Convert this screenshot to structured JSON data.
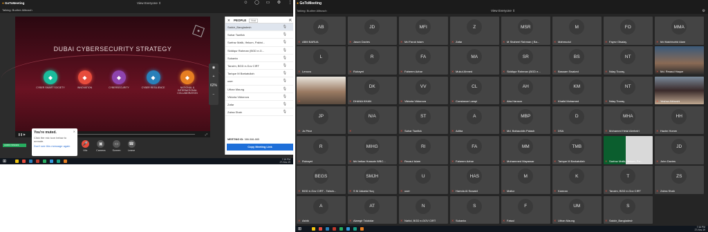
{
  "left": {
    "app": "GoToMeeting",
    "talking": "Talking: Budhre Alibusch",
    "view_label": "View Everyone",
    "presentation": {
      "title": "DUBAI CYBERSECURITY STRATEGY",
      "pillars": [
        {
          "label": "CYBER SMART SOCIETY",
          "color": "#1abc9c"
        },
        {
          "label": "INNOVATION",
          "color": "#e74c3c"
        },
        {
          "label": "CYBERSECURITY",
          "color": "#8e44ad"
        },
        {
          "label": "CYBER RESILIENCE",
          "color": "#2980b9"
        },
        {
          "label": "NATIONAL & INTERNATIONAL COLLABORATION",
          "color": "#e67e22"
        }
      ]
    },
    "zoom_level": "62%",
    "people": {
      "header": "PEOPLE",
      "tag": "Host",
      "items": [
        "Sakkir_Bangladesh",
        "Sahar Tawfick",
        "Sarfraz Malik, Ifekum, Pakist...",
        "Siddiqur Rahman (BGD e-G...",
        "Sukanta",
        "Tanzim, BGD e-Gov CIRT",
        "Tarique M Barkatullah",
        "user",
        "Uthan Maung",
        "Viktoria Viktorova",
        "Zafar",
        "Zahra Shah"
      ],
      "meeting_id_label": "MEETING ID:",
      "meeting_id": "386-566-885",
      "copy_btn": "Copy Meeting Link"
    },
    "muted": {
      "title": "You're muted.",
      "hint": "Click the mic icon below to unmute.",
      "link": "Don't see this message again"
    },
    "controls": [
      {
        "label": "Mic",
        "icon": "🎤",
        "color": "#e74c3c"
      },
      {
        "label": "Camera",
        "icon": "▣",
        "color": "#555"
      },
      {
        "label": "Screen",
        "icon": "▭",
        "color": "#555"
      },
      {
        "label": "Leave",
        "icon": "☎",
        "color": "#555"
      }
    ],
    "audio_label": "AUDIO ISSUES",
    "clock_time": "7:15 PM",
    "clock_date": "27-Nov-19"
  },
  "right": {
    "app": "GoToMeeting",
    "talking": "Talking: Budhre Alibusch",
    "view_label": "View Everyone",
    "tiles": [
      {
        "i": "AB",
        "n": "ABM BARUA"
      },
      {
        "i": "JD",
        "n": "Jason Davies"
      },
      {
        "i": "MFI",
        "n": "Md Faruk Islam"
      },
      {
        "i": "Z",
        "n": "Zafar"
      },
      {
        "i": "MSR",
        "n": "M Shaheel Rahman ( Ba..."
      },
      {
        "i": "M",
        "n": "Mahmudul"
      },
      {
        "i": "FO",
        "n": "Fayez Olsaiay"
      },
      {
        "i": "MMA",
        "n": "Md Makhbuhid Alam"
      },
      {
        "i": "L",
        "n": "Lenovo"
      },
      {
        "i": "R",
        "n": "Rubayet"
      },
      {
        "i": "FA",
        "n": "Faheem Azhar"
      },
      {
        "i": "MA",
        "n": "Mukul Ahmed"
      },
      {
        "i": "SR",
        "n": "Siddiqur Rahman (BGD e..."
      },
      {
        "i": "BS",
        "n": "Bassam Swaked"
      },
      {
        "i": "NT",
        "n": "Nday Touray"
      },
      {
        "i": "",
        "n": "Md. Reaaul Haque",
        "photo": "glasses"
      },
      {
        "i": "",
        "n": "",
        "photo": "man"
      },
      {
        "i": "DK",
        "n": "DHANA KHAN"
      },
      {
        "i": "VV",
        "n": "Viktoria Viktorova"
      },
      {
        "i": "CL",
        "n": "Constance Lampl"
      },
      {
        "i": "AH",
        "n": "Aba Hanson"
      },
      {
        "i": "KM",
        "n": "Khalid Mohamed"
      },
      {
        "i": "NT",
        "n": "Nday Touray"
      },
      {
        "i": "",
        "n": "Yeshra Alkhoshi",
        "photo": "woman"
      },
      {
        "i": "JP",
        "n": "Jo Price"
      },
      {
        "i": "N/A",
        "n": ""
      },
      {
        "i": "ST",
        "n": "Sahar Tawfick"
      },
      {
        "i": "A",
        "n": "Adiba"
      },
      {
        "i": "MBP",
        "n": "Md. Bahauddin Palash"
      },
      {
        "i": "D",
        "n": "DSA"
      },
      {
        "i": "MHA",
        "n": "Mohamed Helal Alreheiri"
      },
      {
        "i": "HH",
        "n": "Hazim Homer"
      },
      {
        "i": "R",
        "n": "Rubayet"
      },
      {
        "i": "MIHG",
        "n": "Md Imtiaz Hussain WBC..."
      },
      {
        "i": "RI",
        "n": "Rezaul Islam"
      },
      {
        "i": "FA",
        "n": "Faheem Azhar"
      },
      {
        "i": "MM",
        "n": "Mohammed Mayassar"
      },
      {
        "i": "TMB",
        "n": "Tarique M Barkatullah"
      },
      {
        "i": "",
        "n": "Sarfraz Malik, Ifekum, Pa...",
        "photo": "flag"
      },
      {
        "i": "JD",
        "n": "John Davies"
      },
      {
        "i": "BEGS",
        "n": "BGD e-Gov CIRT - Tahsin..."
      },
      {
        "i": "SMJH",
        "n": "S M Jakaria Huq"
      },
      {
        "i": "U",
        "n": "user"
      },
      {
        "i": "HAS",
        "n": "Hamda Al Suwaidi"
      },
      {
        "i": "M",
        "n": "Maitur"
      },
      {
        "i": "K",
        "n": "Kamran"
      },
      {
        "i": "T",
        "n": "Tanzim, BGD e-Gov CIRT"
      },
      {
        "i": "ZS",
        "n": "Zahra Shah"
      },
      {
        "i": "A",
        "n": "Ashik"
      },
      {
        "i": "AT",
        "n": "Alamgir Talukdar"
      },
      {
        "i": "N",
        "n": "Nahid, BGD e-GOV CIRT"
      },
      {
        "i": "S",
        "n": "Sukanta"
      },
      {
        "i": "F",
        "n": "Faisal"
      },
      {
        "i": "UM",
        "n": "Uthan Maung"
      },
      {
        "i": "S",
        "n": "Sakkir_Bangladesh"
      }
    ],
    "clock_time": "7:16 PM",
    "clock_date": "27-Nov-19"
  }
}
